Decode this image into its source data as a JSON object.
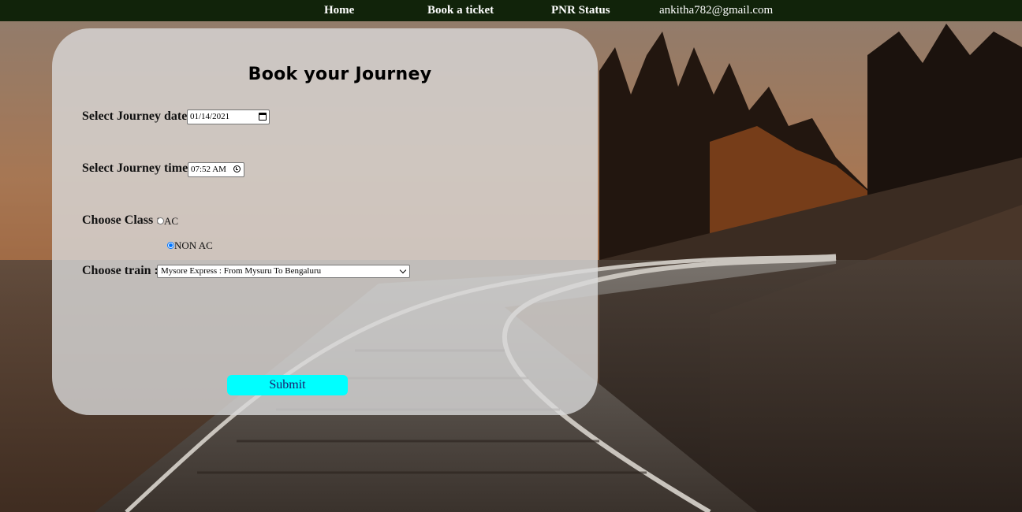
{
  "nav": {
    "home": "Home",
    "book": "Book a ticket",
    "pnr": "PNR Status",
    "user_email": "ankitha782@gmail.com"
  },
  "form": {
    "title": "Book your Journey",
    "date_label": "Select Journey date :",
    "date_value": "01/14/2021",
    "time_label": "Select Journey time :",
    "time_value": "07:52 AM",
    "class_label": "Choose Class :",
    "class_options": [
      "AC",
      "NON AC"
    ],
    "class_selected": "NON AC",
    "train_label": "Choose train :",
    "train_selected": "Mysore Express : From Mysuru To Bengaluru",
    "submit_label": "Submit"
  },
  "colors": {
    "navbar": "#11230a",
    "submit": "#00ffff",
    "radio_accent": "#0075ff"
  }
}
